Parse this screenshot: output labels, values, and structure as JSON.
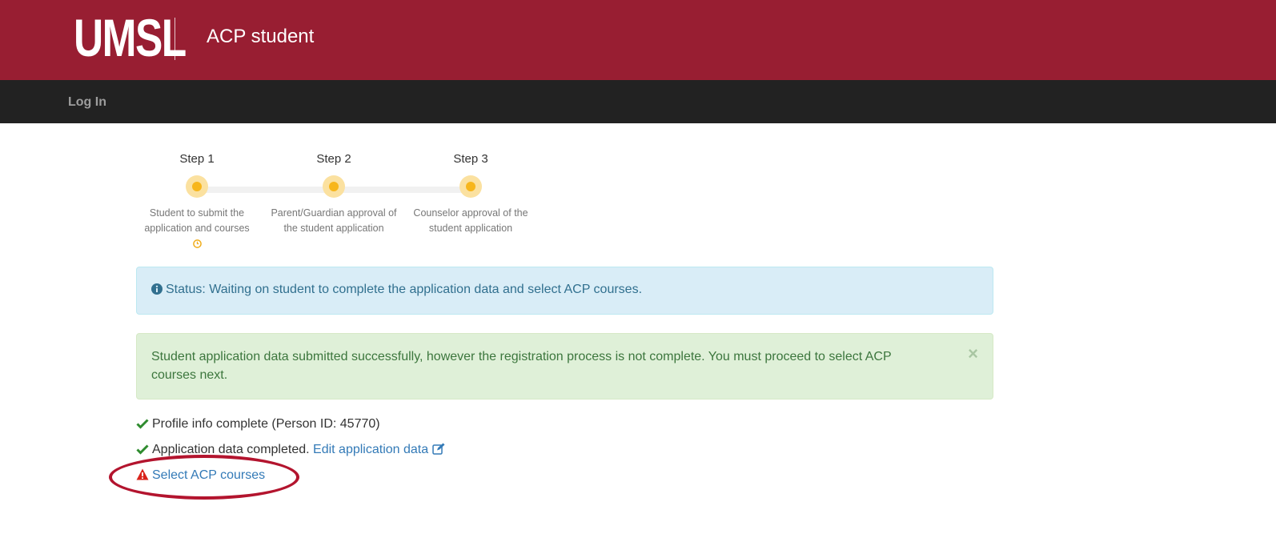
{
  "header": {
    "logo_text": "UMSL",
    "app_title": "ACP student",
    "brand_color": "#981e32"
  },
  "nav": {
    "login_label": "Log In"
  },
  "steps": [
    {
      "title": "Step 1",
      "description_line1": "Student to submit the",
      "description_line2": "application and courses",
      "status_icon": "clock-icon"
    },
    {
      "title": "Step 2",
      "description_line1": "Parent/Guardian approval of",
      "description_line2": "the student application"
    },
    {
      "title": "Step 3",
      "description_line1": "Counselor approval of the",
      "description_line2": "student application"
    }
  ],
  "status_alert": {
    "text": "Status: Waiting on student to complete the application data and select ACP courses.",
    "icon": "info-circle-icon"
  },
  "success_alert": {
    "text": "Student application data submitted successfully, however the registration process is not complete. You must proceed to select ACP courses next.",
    "close_label": "×"
  },
  "checklist": {
    "profile": {
      "text": "Profile info complete (Person ID: 45770)",
      "icon": "check-icon"
    },
    "application": {
      "text": "Application data completed.",
      "link_label": "Edit application data",
      "link_icon": "edit-icon",
      "icon": "check-icon"
    },
    "courses": {
      "link_label": "Select ACP courses",
      "icon": "warning-icon"
    }
  },
  "colors": {
    "step_active": "#f7b61c",
    "info_bg": "#d9edf7",
    "success_bg": "#dff0d8",
    "link": "#337ab7",
    "check": "#2e8b2e",
    "warning": "#d9241c"
  }
}
